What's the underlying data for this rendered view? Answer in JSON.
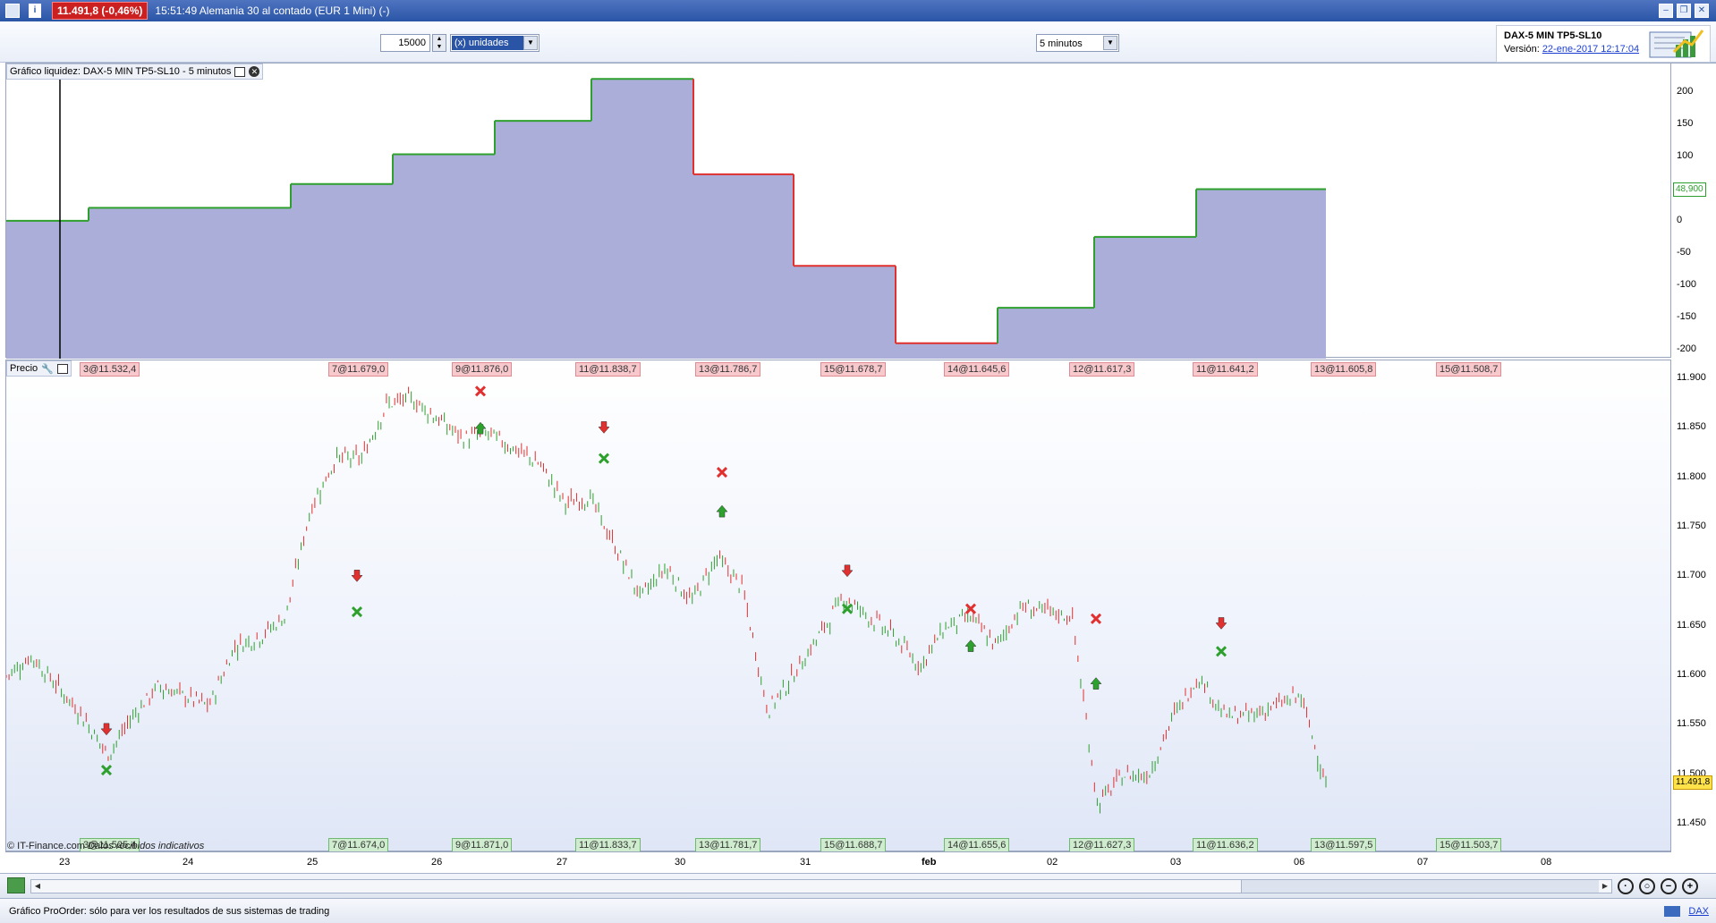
{
  "titlebar": {
    "price_badge": "11.491,8 (-0,46%)",
    "title": "15:51:49 Alemania 30 al contado (EUR 1 Mini) (-)"
  },
  "toolbar": {
    "quantity": "15000",
    "units": "(x) unidades",
    "timeframe": "5 minutos"
  },
  "system": {
    "name": "DAX-5 MIN TP5-SL10",
    "version_label": "Versión:",
    "version_date": "22-ene-2017 12:17:04"
  },
  "equity_panel": {
    "label": "Gráfico liquidez: DAX-5 MIN TP5-SL10 - 5 minutos",
    "y_ticks": [
      "200",
      "150",
      "100",
      "50",
      "0",
      "-50",
      "-100",
      "-150",
      "-200"
    ],
    "last_value": "48,900",
    "fill_color": "#aaaed8",
    "gain_color": "#2ea02e",
    "loss_color": "#e0302f"
  },
  "price_panel": {
    "label": "Precio",
    "y_ticks": [
      "11.900",
      "11.850",
      "11.800",
      "11.750",
      "11.700",
      "11.650",
      "11.600",
      "11.550",
      "11.500",
      "11.450"
    ],
    "last_price": "11.491,8",
    "top_tags": [
      "3@11.532,4",
      "7@11.679,0",
      "9@11.876,0",
      "11@11.838,7",
      "13@11.786,7",
      "15@11.678,7",
      "14@11.645,6",
      "12@11.617,3",
      "11@11.641,2",
      "13@11.605,8",
      "15@11.508,7"
    ],
    "bottom_tags": [
      "3@11.525,4",
      "7@11.674,0",
      "9@11.871,0",
      "11@11.833,7",
      "13@11.781,7",
      "15@11.688,7",
      "14@11.655,6",
      "12@11.627,3",
      "11@11.636,2",
      "13@11.597,5",
      "15@11.503,7"
    ],
    "credit_prefix": "© IT-Finance.com",
    "credit_note": "Datos recibidos indicativos"
  },
  "date_axis": {
    "labels": [
      "23",
      "24",
      "25",
      "26",
      "27",
      "30",
      "31",
      "feb",
      "02",
      "03",
      "06",
      "07",
      "08"
    ]
  },
  "chart_data": {
    "type": "line",
    "equity": {
      "series_values": [
        0,
        20,
        57,
        103,
        155,
        220,
        72,
        -70,
        -190,
        -135,
        -25,
        48.9
      ],
      "ylim": [
        -200,
        230
      ]
    },
    "price": {
      "ylim": [
        11440,
        11910
      ],
      "approx_path": [
        11600,
        11620,
        11590,
        11560,
        11520,
        11560,
        11590,
        11580,
        11570,
        11630,
        11640,
        11660,
        11770,
        11820,
        11820,
        11875,
        11880,
        11860,
        11840,
        11845,
        11830,
        11815,
        11775,
        11780,
        11730,
        11680,
        11710,
        11675,
        11720,
        11690,
        11565,
        11600,
        11640,
        11680,
        11660,
        11640,
        11610,
        11650,
        11660,
        11630,
        11670,
        11665,
        11660,
        11470,
        11500,
        11500,
        11560,
        11600,
        11560,
        11560,
        11570,
        11580,
        11491.8
      ]
    }
  },
  "statusbar": {
    "text": "Gráfico ProOrder: sólo para ver los resultados de sus sistemas de trading",
    "right_link": "DAX"
  }
}
